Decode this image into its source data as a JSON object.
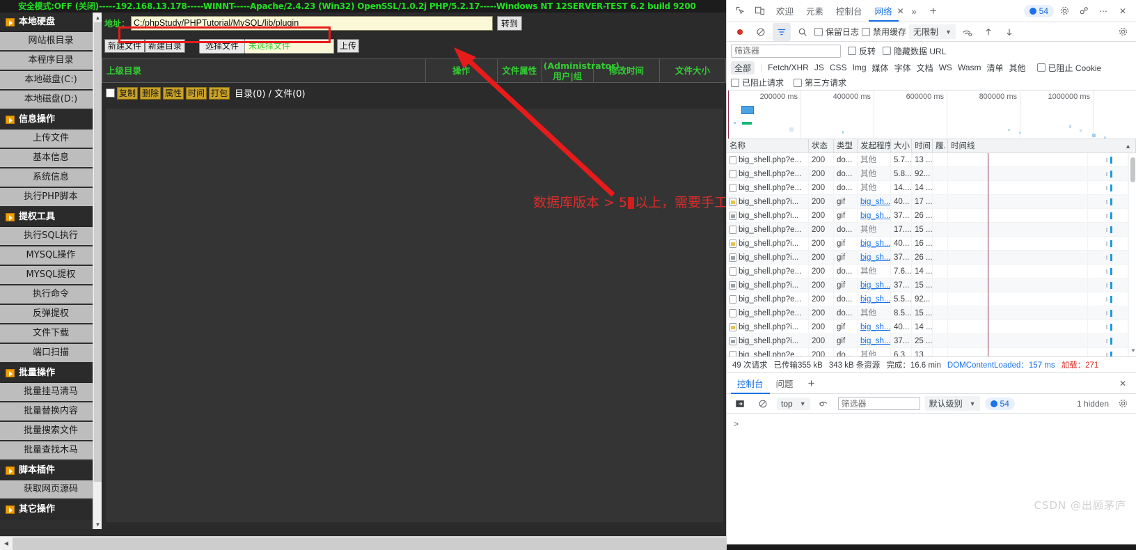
{
  "shell": {
    "statusbar": "安全模式:OFF (关闭)-----192.168.13.178-----WINNT-----Apache/2.4.23 (Win32) OpenSSL/1.0.2j PHP/5.2.17-----Windows NT 12SERVER-TEST 6.2 build 9200",
    "sidebar": {
      "items": [
        {
          "type": "group",
          "label": "本地硬盘"
        },
        {
          "type": "item",
          "label": "网站根目录"
        },
        {
          "type": "item",
          "label": "本程序目录"
        },
        {
          "type": "item",
          "label": "本地磁盘(C:)"
        },
        {
          "type": "item",
          "label": "本地磁盘(D:)"
        },
        {
          "type": "group",
          "label": "信息操作"
        },
        {
          "type": "item",
          "label": "上传文件"
        },
        {
          "type": "item",
          "label": "基本信息"
        },
        {
          "type": "item",
          "label": "系统信息"
        },
        {
          "type": "item",
          "label": "执行PHP脚本"
        },
        {
          "type": "group",
          "label": "提权工具"
        },
        {
          "type": "item",
          "label": "执行SQL执行"
        },
        {
          "type": "item",
          "label": "MYSQL操作"
        },
        {
          "type": "item",
          "label": "MYSQL提权"
        },
        {
          "type": "item",
          "label": "执行命令"
        },
        {
          "type": "item",
          "label": "反弹提权"
        },
        {
          "type": "item",
          "label": "文件下载"
        },
        {
          "type": "item",
          "label": "端口扫描"
        },
        {
          "type": "group",
          "label": "批量操作"
        },
        {
          "type": "item",
          "label": "批量挂马清马"
        },
        {
          "type": "item",
          "label": "批量替换内容"
        },
        {
          "type": "item",
          "label": "批量搜索文件"
        },
        {
          "type": "item",
          "label": "批量查找木马"
        },
        {
          "type": "group",
          "label": "脚本插件"
        },
        {
          "type": "item",
          "label": "获取网页源码"
        },
        {
          "type": "group",
          "label": "其它操作"
        }
      ]
    },
    "address": {
      "label": "地址：",
      "value": "C:/phpStudy/PHPTutorial/MySQL/lib/plugin",
      "goto_label": "转到"
    },
    "buttons": {
      "new_file": "新建文件",
      "new_dir": "新建目录",
      "choose_file": "选择文件",
      "no_file_chosen": "未选择文件",
      "upload": "上传"
    },
    "table": {
      "headers": [
        "上级目录",
        "操作",
        "文件属性",
        "(Administrator)用户|组",
        "修改时间",
        "文件大小"
      ]
    },
    "ops": {
      "copy": "复制",
      "delete": "删除",
      "attr": "属性",
      "time": "时间",
      "pack": "打包",
      "counts": "目录(0) / 文件(0)"
    },
    "annotation": {
      "text_before": "数据库版本 > 5",
      "text_after": "以上，需要手工创建目录"
    }
  },
  "devtools": {
    "tabs": [
      {
        "label": "欢迎",
        "active": false
      },
      {
        "label": "元素",
        "active": false
      },
      {
        "label": "控制台",
        "active": false
      },
      {
        "label": "网络",
        "active": true
      }
    ],
    "more_tabs": "»",
    "add_tab": "+",
    "issues_count": "54",
    "icons": {
      "inspect": "inspect-icon",
      "device": "device-toolbar-icon",
      "settings": "gear-icon",
      "customize": "more-options-icon",
      "close": "close-icon",
      "record": "record-icon",
      "clear": "clear-icon",
      "filter": "filter-icon",
      "search": "search-icon",
      "throttle": "network-conditions-icon",
      "import": "import-har-icon",
      "export": "export-har-icon"
    },
    "toolbar": {
      "preserve_log": "保留日志",
      "disable_cache": "禁用缓存",
      "throttling": "无限制"
    },
    "filterbar": {
      "placeholder": "筛选器",
      "invert": "反转",
      "hide_data_urls": "隐藏数据 URL"
    },
    "types": [
      "全部",
      "Fetch/XHR",
      "JS",
      "CSS",
      "Img",
      "媒体",
      "字体",
      "文档",
      "WS",
      "Wasm",
      "清单",
      "其他"
    ],
    "type_active": "全部",
    "blocked_cookies": "已阻止 Cookie",
    "blocked_requests": "已阻止请求",
    "third_party": "第三方请求",
    "overview": {
      "ticks": [
        "200000 ms",
        "400000 ms",
        "600000 ms",
        "800000 ms",
        "1000000 ms"
      ]
    },
    "columns": [
      "名称",
      "状态",
      "类型",
      "发起程序",
      "大小",
      "时间",
      "履.",
      "时间线"
    ],
    "rows": [
      {
        "name": "big_shell.php?e...",
        "status": "200",
        "type": "do...",
        "initiator": "其他",
        "init_link": false,
        "size": "5.7...",
        "time": "13 ...",
        "ico": "doc"
      },
      {
        "name": "big_shell.php?e...",
        "status": "200",
        "type": "do...",
        "initiator": "其他",
        "init_link": false,
        "size": "5.8...",
        "time": "92...",
        "ico": "doc"
      },
      {
        "name": "big_shell.php?e...",
        "status": "200",
        "type": "do...",
        "initiator": "其他",
        "init_link": false,
        "size": "14....",
        "time": "14 ...",
        "ico": "doc"
      },
      {
        "name": "big_shell.php?i...",
        "status": "200",
        "type": "gif",
        "initiator": "big_sh...",
        "init_link": true,
        "size": "40...",
        "time": "17 ...",
        "ico": "gifY"
      },
      {
        "name": "big_shell.php?i...",
        "status": "200",
        "type": "gif",
        "initiator": "big_sh...",
        "init_link": true,
        "size": "37...",
        "time": "26 ...",
        "ico": "gif"
      },
      {
        "name": "big_shell.php?e...",
        "status": "200",
        "type": "do...",
        "initiator": "其他",
        "init_link": false,
        "size": "17....",
        "time": "15 ...",
        "ico": "doc"
      },
      {
        "name": "big_shell.php?i...",
        "status": "200",
        "type": "gif",
        "initiator": "big_sh...",
        "init_link": true,
        "size": "40...",
        "time": "16 ...",
        "ico": "gifY"
      },
      {
        "name": "big_shell.php?i...",
        "status": "200",
        "type": "gif",
        "initiator": "big_sh...",
        "init_link": true,
        "size": "37...",
        "time": "26 ...",
        "ico": "gif"
      },
      {
        "name": "big_shell.php?e...",
        "status": "200",
        "type": "do...",
        "initiator": "其他",
        "init_link": false,
        "size": "7.6...",
        "time": "14 ...",
        "ico": "doc"
      },
      {
        "name": "big_shell.php?i...",
        "status": "200",
        "type": "gif",
        "initiator": "big_sh...",
        "init_link": true,
        "size": "37...",
        "time": "15 ...",
        "ico": "gif"
      },
      {
        "name": "big_shell.php?e...",
        "status": "200",
        "type": "do...",
        "initiator": "big_sh...",
        "init_link": true,
        "size": "5.5...",
        "time": "92...",
        "ico": "doc"
      },
      {
        "name": "big_shell.php?e...",
        "status": "200",
        "type": "do...",
        "initiator": "其他",
        "init_link": false,
        "size": "8.5...",
        "time": "15 ...",
        "ico": "doc"
      },
      {
        "name": "big_shell.php?i...",
        "status": "200",
        "type": "gif",
        "initiator": "big_sh...",
        "init_link": true,
        "size": "40...",
        "time": "14 ...",
        "ico": "gifY"
      },
      {
        "name": "big_shell.php?i...",
        "status": "200",
        "type": "gif",
        "initiator": "big_sh...",
        "init_link": true,
        "size": "37...",
        "time": "25 ...",
        "ico": "gif"
      },
      {
        "name": "big_shell.php?e...",
        "status": "200",
        "type": "do...",
        "initiator": "其他",
        "init_link": false,
        "size": "6.3...",
        "time": "13 ...",
        "ico": "doc"
      }
    ],
    "summary": {
      "requests": "49 次请求",
      "transferred": "已传输355 kB",
      "resources": "343 kB 条资源",
      "finish_label": "完成：",
      "finish_value": "16.6 min",
      "dcl_label": "DOMContentLoaded：",
      "dcl_value": "157 ms",
      "load_label": "加载：",
      "load_value": "271"
    },
    "drawer": {
      "tabs": [
        {
          "label": "控制台",
          "active": true
        },
        {
          "label": "问题",
          "active": false
        }
      ],
      "add": "+",
      "context": "top",
      "filter_placeholder": "筛选器",
      "level": "默认级别",
      "badge_count": "54",
      "hidden": "1 hidden"
    }
  },
  "watermark": "CSDN @出顾茅庐"
}
